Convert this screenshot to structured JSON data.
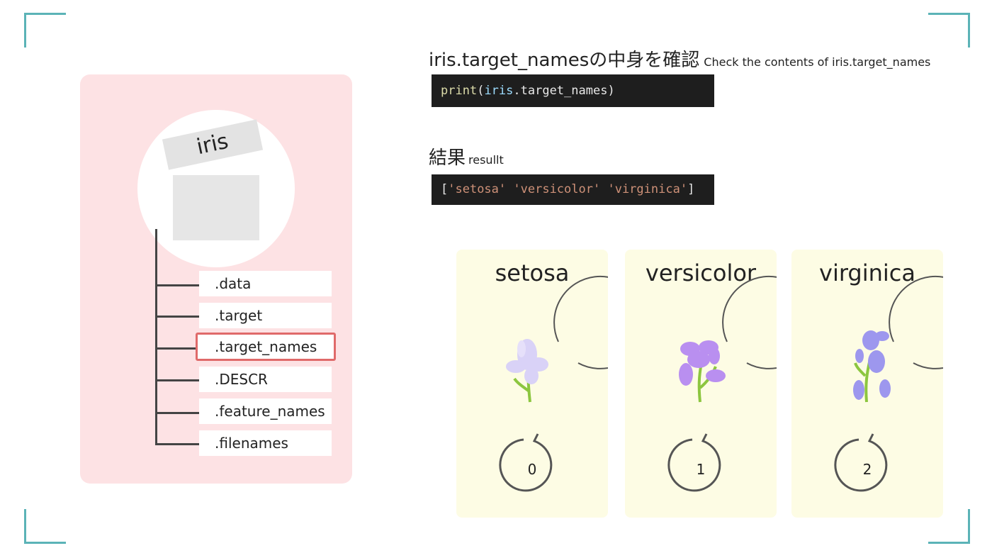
{
  "object": {
    "name": "iris",
    "attributes": [
      {
        "label": ".data",
        "highlighted": false
      },
      {
        "label": ".target",
        "highlighted": false
      },
      {
        "label": ".target_names",
        "highlighted": true
      },
      {
        "label": ".DESCR",
        "highlighted": false
      },
      {
        "label": ".feature_names",
        "highlighted": false
      },
      {
        "label": ".filenames",
        "highlighted": false
      }
    ]
  },
  "heading": {
    "title": "iris.target_namesの中身を確認",
    "subtitle": "Check the contents of iris.target_names"
  },
  "code": {
    "fn": "print",
    "open": "(",
    "var": "iris",
    "rest": ".target_names)"
  },
  "result": {
    "title": "結果",
    "subtitle": "resullt",
    "output": {
      "open": "[",
      "s1": "'setosa'",
      "s2": "'versicolor'",
      "s3": "'virginica'",
      "close": "]"
    }
  },
  "species": [
    {
      "name": "setosa",
      "index": "0",
      "color": "#d9d2f7"
    },
    {
      "name": "versicolor",
      "index": "1",
      "color": "#b98ff0"
    },
    {
      "name": "virginica",
      "index": "2",
      "color": "#9d97ee"
    }
  ],
  "colors": {
    "accent_corner": "#5bb3b7",
    "panel": "#fde2e4",
    "highlight": "#e06a6a",
    "card": "#fdfce4",
    "stem": "#8cc63f"
  }
}
